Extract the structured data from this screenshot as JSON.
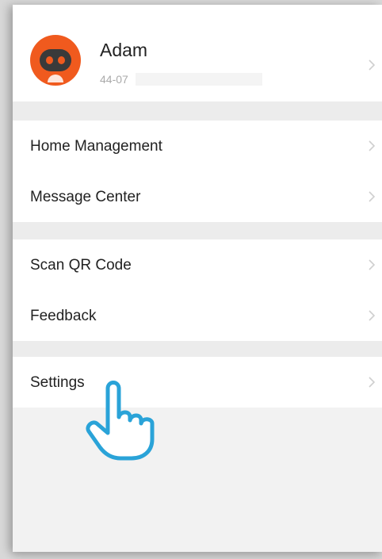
{
  "profile": {
    "name": "Adam",
    "id_text": "44-07",
    "avatar_icon": "robot-avatar-icon",
    "accent_color": "#f05a1e"
  },
  "menu_groups": [
    {
      "items": [
        {
          "label": "Home Management"
        },
        {
          "label": "Message Center"
        }
      ]
    },
    {
      "items": [
        {
          "label": "Scan QR Code"
        },
        {
          "label": "Feedback"
        }
      ]
    },
    {
      "items": [
        {
          "label": "Settings"
        }
      ]
    }
  ],
  "pointer": {
    "icon": "pointing-hand-icon",
    "target": "Settings",
    "color": "#2aa3d8"
  }
}
